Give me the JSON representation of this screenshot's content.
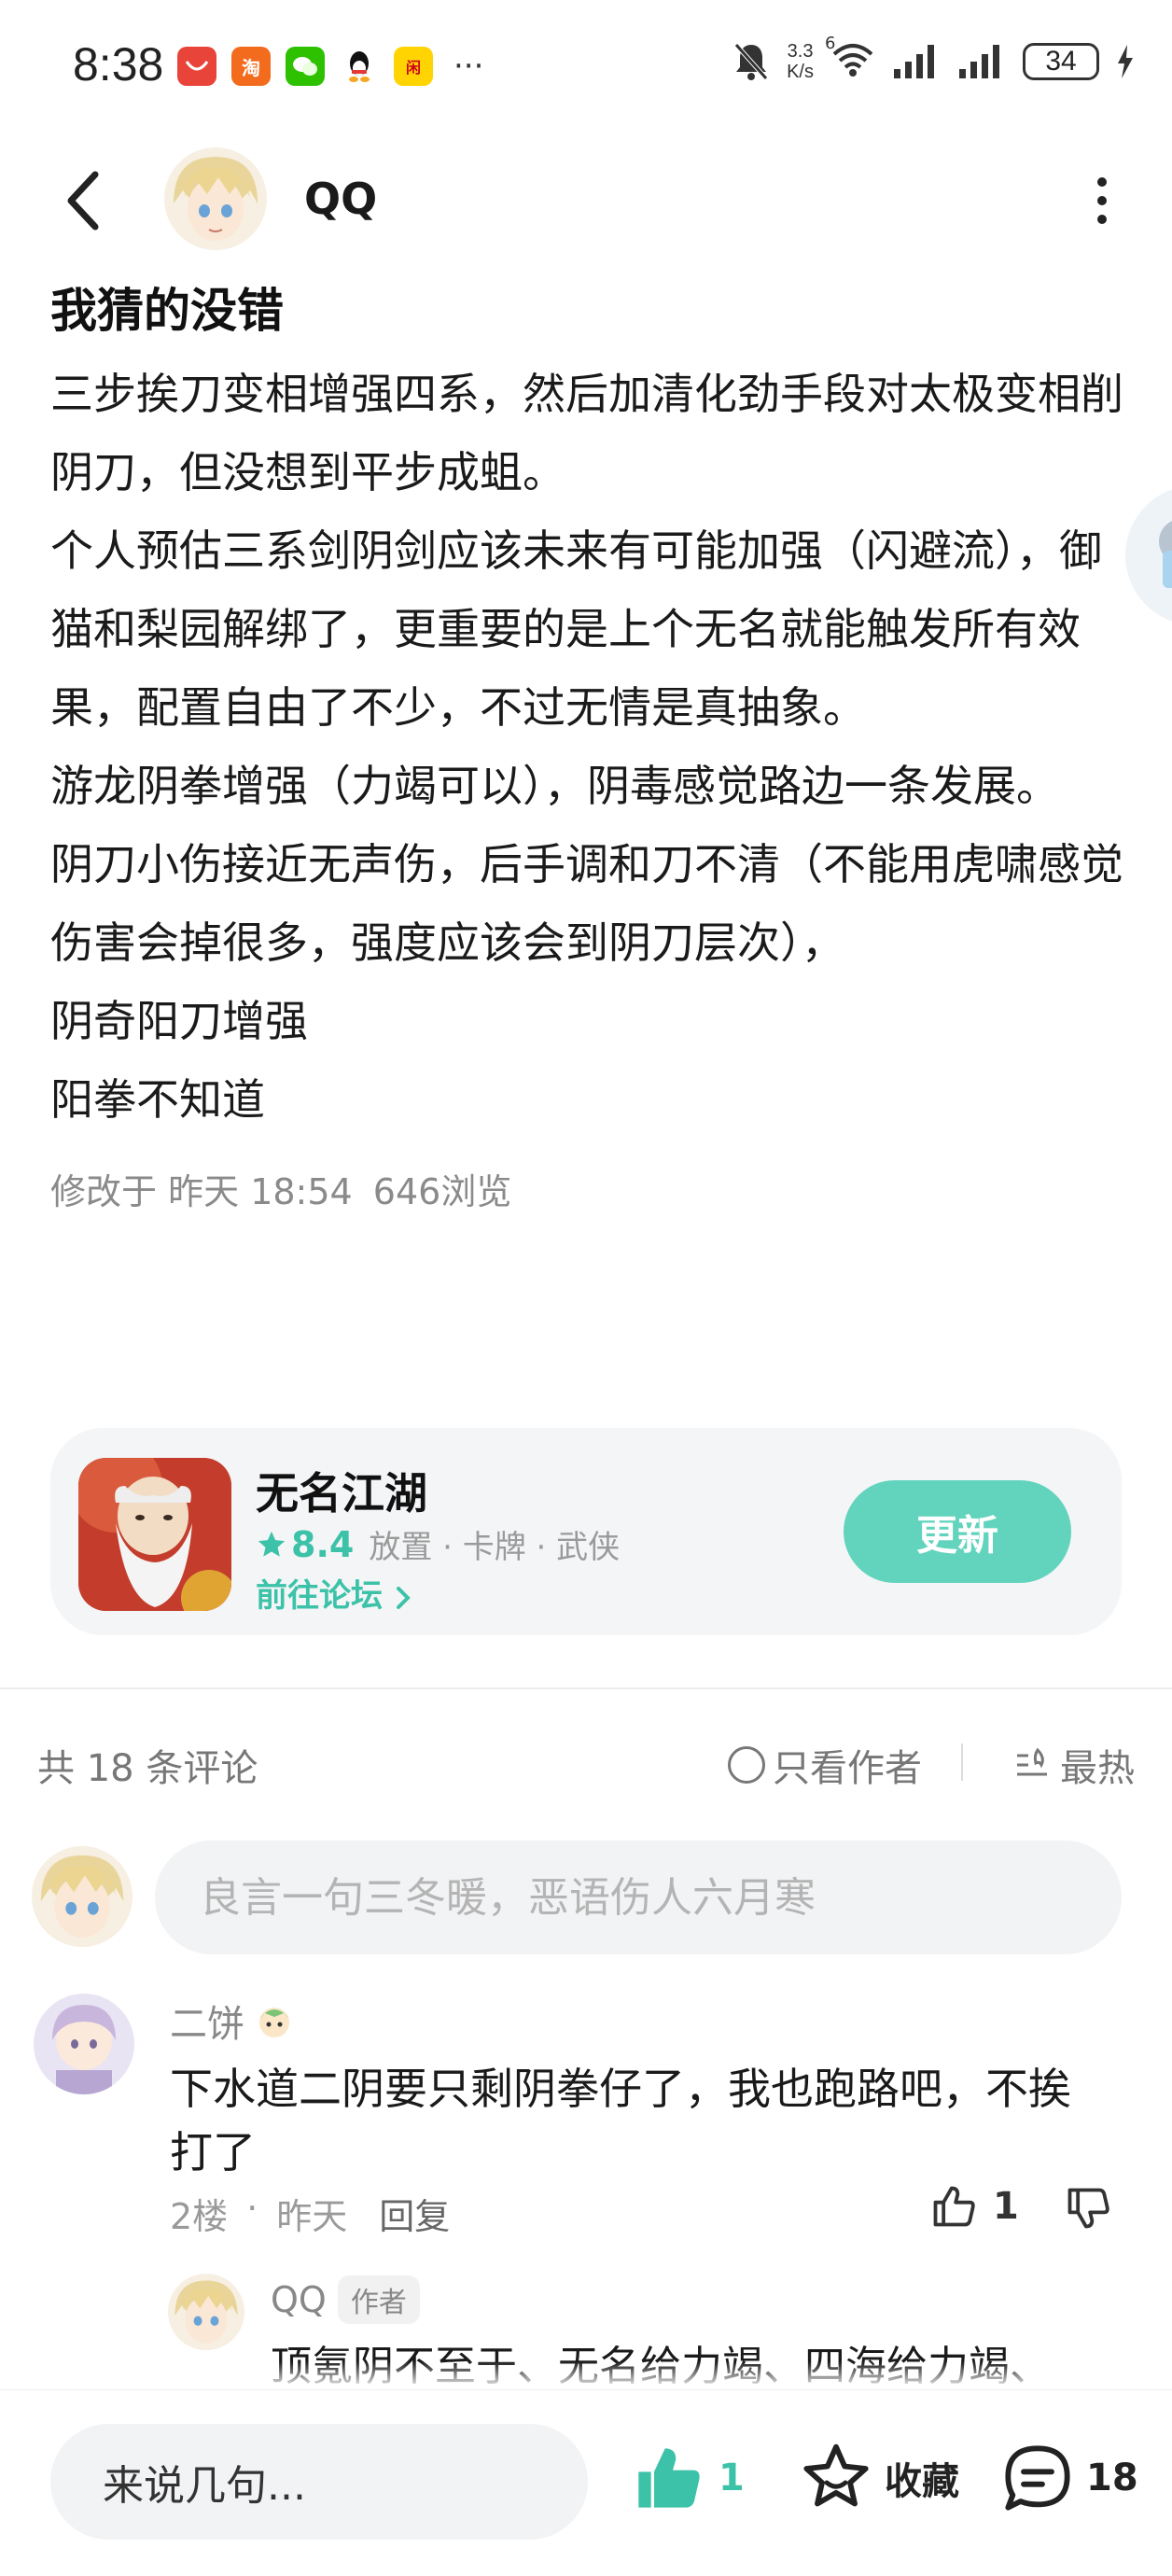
{
  "status_bar": {
    "time": "8:38",
    "net_speed_value": "3.3",
    "net_speed_unit": "K/s",
    "network_type": "6",
    "battery": "34",
    "more": "···"
  },
  "header": {
    "author_name": "QQ"
  },
  "post": {
    "title": "我猜的没错",
    "paragraphs": [
      "三步挨刀变相增强四系，然后加清化劲手段对太极变相削阴刀，但没想到平步成蛆。",
      "个人预估三系剑阴剑应该未来有可能加强（闪避流），御猫和梨园解绑了，更重要的是上个无名就能触发所有效果，配置自由了不少，不过无情是真抽象。",
      "游龙阴拳增强（力竭可以），阴毒感觉路边一条发展。",
      "阴刀小伤接近无声伤，后手调和刀不清（不能用虎啸感觉伤害会掉很多，强度应该会到阴刀层次），",
      "阴奇阳刀增强",
      "阳拳不知道"
    ],
    "modified_label": "修改于",
    "modified_time": "昨天 18:54",
    "views": "646浏览"
  },
  "app_card": {
    "name": "无名江湖",
    "rating": "8.4",
    "tags": "放置 · 卡牌 · 武侠",
    "forum_link": "前往论坛",
    "update_button": "更新"
  },
  "comments": {
    "count_label": "共 18 条评论",
    "only_author": "只看作者",
    "sort": "最热",
    "input_placeholder": "良言一句三冬暖，恶语伤人六月寒",
    "items": [
      {
        "author": "二饼",
        "text": "下水道二阴要只剩阴拳仔了，我也跑路吧，不挨打了",
        "floor": "2楼",
        "time": "昨天",
        "reply_label": "回复",
        "likes": "1",
        "reply": {
          "author": "QQ",
          "badge": "作者",
          "text": "顶氪阴不至于、无名给力竭、四海给力竭、"
        }
      }
    ]
  },
  "bottom_bar": {
    "input_placeholder": "来说几句...",
    "like_count": "1",
    "favorite_label": "收藏",
    "comment_count": "18"
  },
  "colors": {
    "accent": "#3cc2a8",
    "update_button": "#62d4bd",
    "muted_text": "#8a8a8a"
  },
  "icons": [
    "back-icon",
    "more-icon",
    "star-icon",
    "chevron-right-icon",
    "circle-icon",
    "sort-hot-icon",
    "thumb-up-icon",
    "thumb-down-icon",
    "favorite-icon",
    "comment-icon"
  ]
}
